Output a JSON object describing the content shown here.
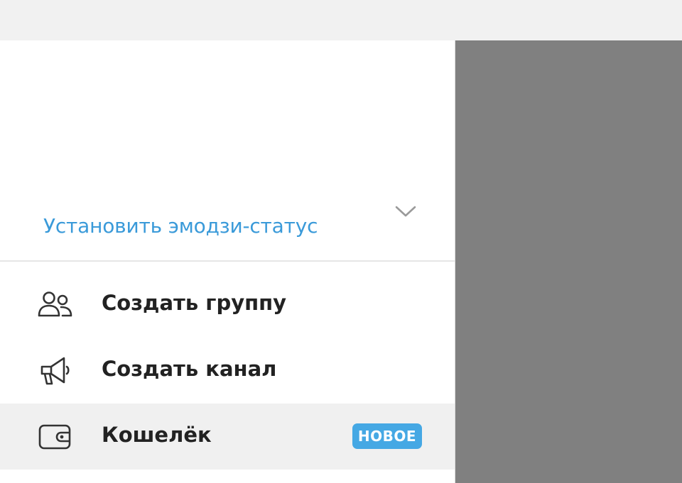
{
  "header": {
    "emoji_status_label": "Установить эмодзи-статус",
    "expand_icon": "chevron-down-icon"
  },
  "menu": {
    "items": [
      {
        "label": "Создать группу",
        "icon": "group-icon"
      },
      {
        "label": "Создать канал",
        "icon": "megaphone-icon"
      },
      {
        "label": "Кошелёк",
        "icon": "wallet-icon",
        "badge": "НОВОЕ",
        "highlighted": true
      }
    ]
  },
  "colors": {
    "accent": "#3a9ad9",
    "badge": "#45a8e4",
    "overlay": "#808080",
    "hover": "#f0f0f0",
    "text": "#222222"
  }
}
